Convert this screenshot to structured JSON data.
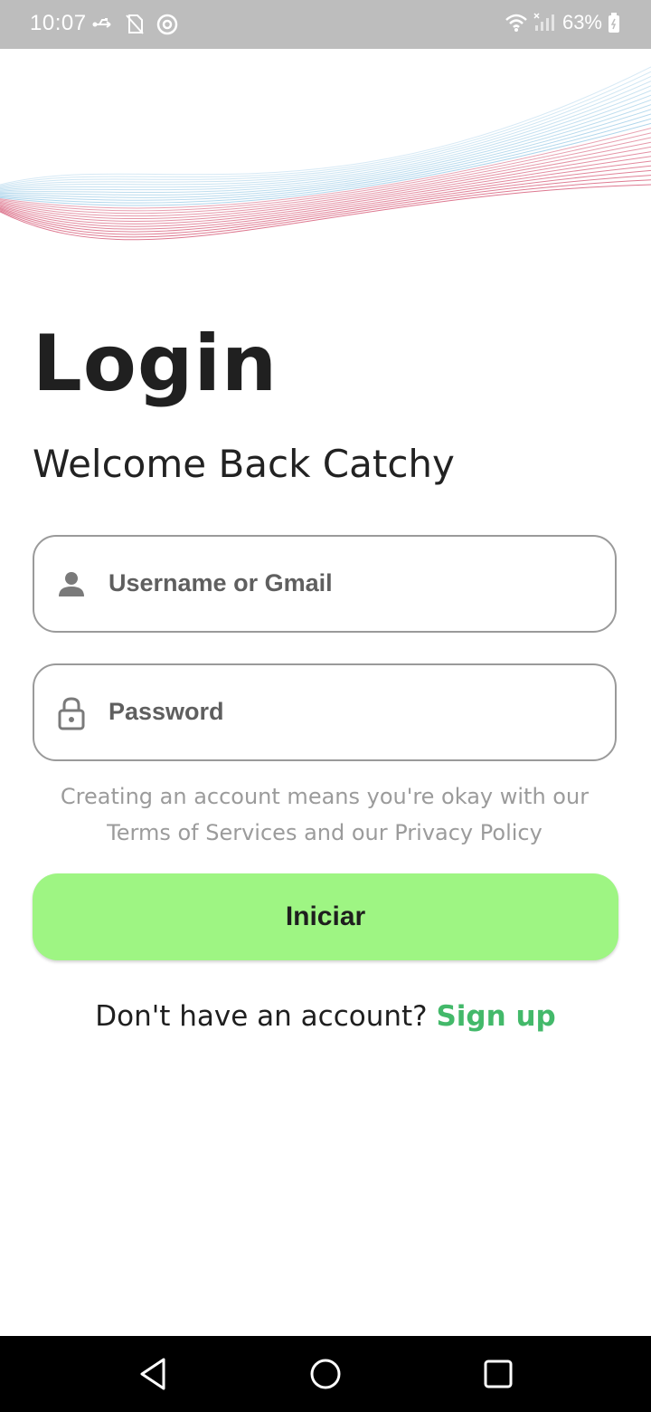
{
  "status_bar": {
    "time": "10:07",
    "battery": "63%",
    "icons": [
      "usb-icon",
      "no-sim-icon",
      "data-saver-icon",
      "wifi-icon",
      "signal-icon",
      "battery-icon"
    ]
  },
  "login": {
    "title": "Login",
    "subtitle": "Welcome Back Catchy"
  },
  "form": {
    "username_placeholder": "Username or Gmail",
    "password_placeholder": "Password"
  },
  "terms": {
    "line1": "Creating an account means you're okay with our",
    "line2": "Terms of Services and our Privacy Policy"
  },
  "actions": {
    "login_button": "Iniciar",
    "signup_prompt": "Don't have an account?",
    "signup_link": "Sign up"
  },
  "colors": {
    "button_bg": "#9ef583",
    "link": "#43b96a",
    "wave_blue": "#5aa9d6",
    "wave_red": "#d24a6a"
  },
  "nav_bar": {
    "icons": [
      "back-icon",
      "home-icon",
      "recent-apps-icon"
    ]
  }
}
